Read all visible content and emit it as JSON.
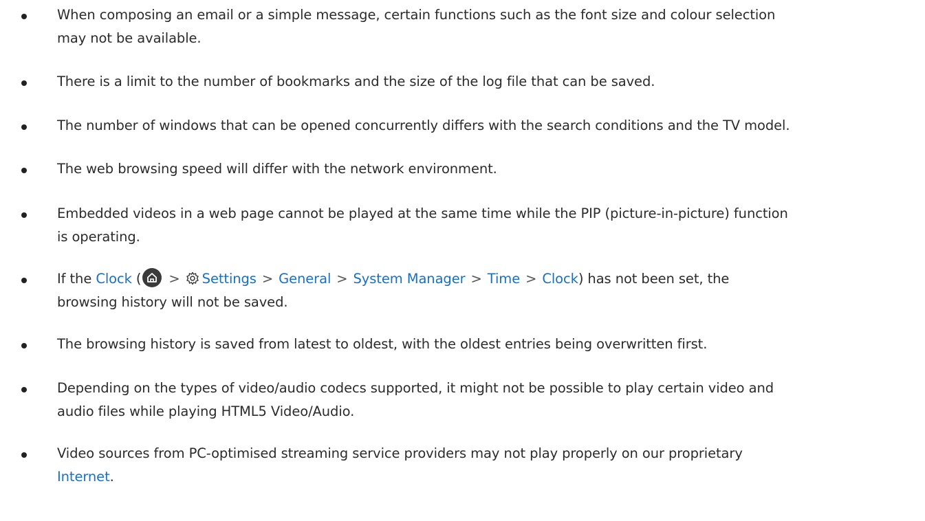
{
  "items": [
    {
      "line1": "When composing an email or a simple message, certain functions such as the font size and colour selection",
      "line2": "may not be available."
    },
    {
      "line1": "There is a limit to the number of bookmarks and the size of the log file that can be saved."
    },
    {
      "line1": "The number of windows that can be opened concurrently differs with the search conditions and the TV model."
    },
    {
      "line1": "The web browsing speed will differ with the network environment."
    },
    {
      "line1": "Embedded videos in a web page cannot be played at the same time while the PIP (picture-in-picture) function",
      "line2": "is operating."
    },
    {
      "prefix": "If the ",
      "clock_link": "Clock",
      "open_paren": " (",
      "path": [
        "Settings",
        "General",
        "System Manager",
        "Time",
        "Clock"
      ],
      "separator": ">",
      "suffix": ") has not been set, the",
      "line2": "browsing history will not be saved."
    },
    {
      "line1": "The browsing history is saved from latest to oldest, with the oldest entries being overwritten first."
    },
    {
      "line1": "Depending on the types of video/audio codecs supported, it might not be possible to play certain video and",
      "line2": "audio files while playing HTML5 Video/Audio."
    },
    {
      "line1": "Video sources from PC-optimised streaming service providers may not play properly on our proprietary",
      "line2_link": "Internet",
      "line2_suffix": "."
    }
  ],
  "colors": {
    "text": "#2b2b2b",
    "link": "#1a6fbf",
    "icon_bg": "#3a3a3a"
  },
  "icons": {
    "home": "home-icon",
    "settings": "gear-icon"
  }
}
